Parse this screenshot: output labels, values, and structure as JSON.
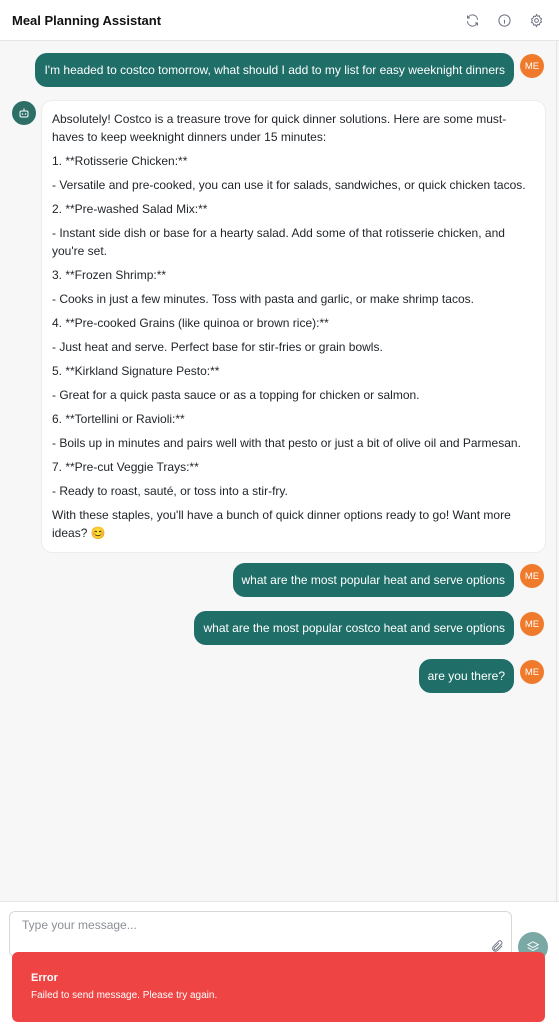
{
  "header": {
    "title": "Meal Planning Assistant",
    "actions": [
      {
        "icon": "refresh-icon"
      },
      {
        "icon": "info-icon"
      },
      {
        "icon": "gear-icon"
      }
    ]
  },
  "user_avatar_label": "ME",
  "messages": {
    "user1": "I'm headed to costco tomorrow, what should I add to my list for easy weeknight dinners",
    "bot1": [
      "Absolutely! Costco is a treasure trove for quick dinner solutions. Here are some must-haves to keep weeknight dinners under 15 minutes:",
      "1. **Rotisserie Chicken:**",
      "- Versatile and pre-cooked, you can use it for salads, sandwiches, or quick chicken tacos.",
      "2. **Pre-washed Salad Mix:**",
      "- Instant side dish or base for a hearty salad. Add some of that rotisserie chicken, and you're set.",
      "3. **Frozen Shrimp:**",
      "- Cooks in just a few minutes. Toss with pasta and garlic, or make shrimp tacos.",
      "4. **Pre-cooked Grains (like quinoa or brown rice):**",
      "- Just heat and serve. Perfect base for stir-fries or grain bowls.",
      "5. **Kirkland Signature Pesto:**",
      "- Great for a quick pasta sauce or as a topping for chicken or salmon.",
      "6. **Tortellini or Ravioli:**",
      "- Boils up in minutes and pairs well with that pesto or just a bit of olive oil and Parmesan.",
      "7. **Pre-cut Veggie Trays:**",
      "- Ready to roast, sauté, or toss into a stir-fry.",
      "With these staples, you'll have a bunch of quick dinner options ready to go! Want more ideas? 😊"
    ],
    "user2": "what are the most popular heat and serve options",
    "user3": "what are the most popular costco heat and serve options",
    "user4": "are you there?"
  },
  "input": {
    "placeholder": "Type your message...",
    "value": ""
  },
  "toast": {
    "title": "Error",
    "message": "Failed to send message. Please try again."
  },
  "colors": {
    "user_bubble": "#1f6e68",
    "avatar_me": "#f07a2b",
    "toast_error": "#ef4444"
  }
}
